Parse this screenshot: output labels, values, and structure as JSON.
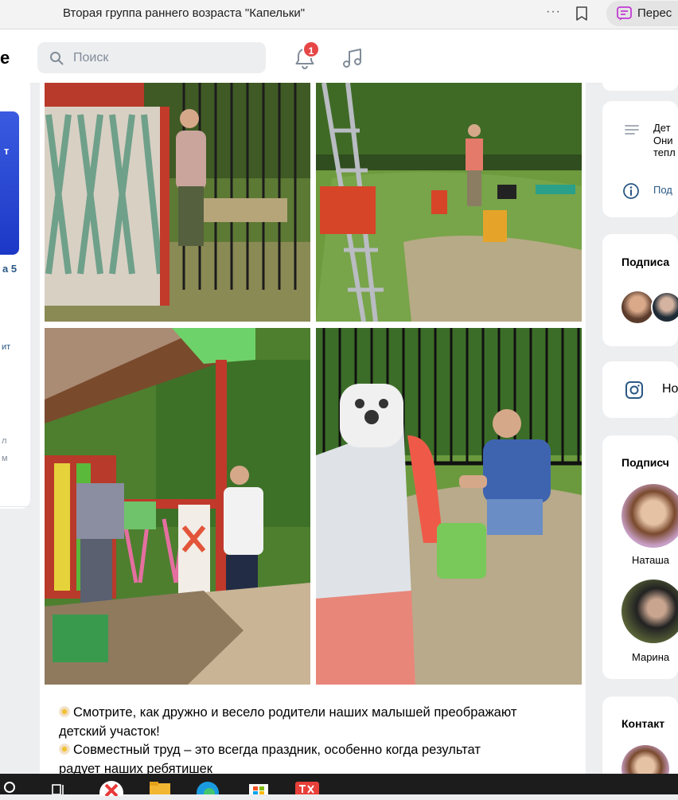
{
  "browser": {
    "tab_title": "Вторая группа раннего возраста \"Капельки\"",
    "more_label": "···",
    "translate_label": "Перес"
  },
  "header": {
    "logo_fragment": "е",
    "search_placeholder": "Поиск",
    "notifications_count": "1",
    "icons": [
      "search-icon",
      "bell-icon",
      "music-icon"
    ]
  },
  "left_sidebar": {
    "banner_text": "т",
    "number_text": "а 5",
    "link_text": "ит",
    "line1": "л",
    "line2": "м"
  },
  "post": {
    "photos": [
      {
        "name": "photo-fence-painting"
      },
      {
        "name": "photo-playground-ladder"
      },
      {
        "name": "photo-gazebo-painting"
      },
      {
        "name": "photo-slide-cleaning"
      }
    ],
    "text_lines": [
      "Смотрите, как дружно и весело родители наших малышей преображают",
      "детский участок!",
      "Совместный труд – это всегда праздник, особенно когда результат",
      "радует наших ребятишек"
    ]
  },
  "right_sidebar": {
    "description_lines": [
      "Дет",
      "Они",
      "тепл"
    ],
    "more_info": "Под",
    "subscriptions_title": "Подписа",
    "instagram_label": "Но",
    "followers_title": "Подписч",
    "followers": [
      {
        "name": "Наташа"
      },
      {
        "name": "Марина"
      }
    ],
    "contacts_title": "Контакт"
  },
  "colors": {
    "accent": "#2a5885",
    "badge": "#e64646",
    "page_bg": "#edeef0"
  }
}
